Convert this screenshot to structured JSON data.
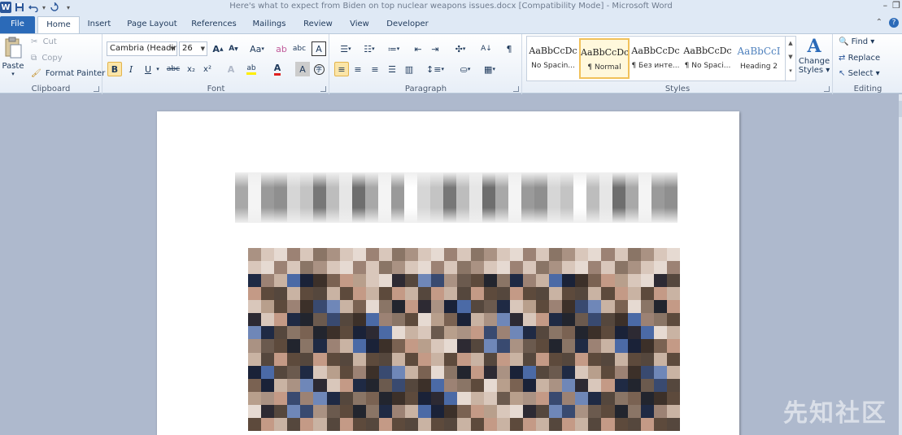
{
  "titlebar": {
    "title": "Here's what to expect from Biden on top nuclear weapons issues.docx [Compatibility Mode]  -  Microsoft Word",
    "minimize": "–",
    "restore": "❐",
    "word_logo": "W",
    "undo_dropdown": "▾",
    "customize": "▾"
  },
  "tabs": [
    {
      "label": "File"
    },
    {
      "label": "Home"
    },
    {
      "label": "Insert"
    },
    {
      "label": "Page Layout"
    },
    {
      "label": "References"
    },
    {
      "label": "Mailings"
    },
    {
      "label": "Review"
    },
    {
      "label": "View"
    },
    {
      "label": "Developer"
    }
  ],
  "clipboard": {
    "paste": "Paste",
    "cut": "Cut",
    "copy": "Copy",
    "format_painter": "Format Painter",
    "label": "Clipboard"
  },
  "font": {
    "font_name": "Cambria (Headir",
    "font_size": "26",
    "label": "Font",
    "grow": "A",
    "shrink": "A",
    "change_case": "Aa",
    "bold": "B",
    "italic": "I",
    "underline": "U",
    "strike": "abc",
    "subscript": "x₂",
    "superscript": "x²",
    "font_color": "A",
    "char_shading": "A"
  },
  "paragraph": {
    "label": "Paragraph",
    "pilcrow": "¶"
  },
  "styles": {
    "label": "Styles",
    "items": [
      {
        "sample": "AaBbCcDc",
        "name": "No Spacin..."
      },
      {
        "sample": "AaBbCcDc",
        "name": "¶ Normal"
      },
      {
        "sample": "AaBbCcDc",
        "name": "¶ Без инте..."
      },
      {
        "sample": "AaBbCcDc",
        "name": "¶ No Spaci..."
      },
      {
        "sample": "AaBbCcI",
        "name": "Heading 2"
      }
    ],
    "change_styles_line1": "Change",
    "change_styles_line2": "Styles ▾"
  },
  "editing": {
    "label": "Editing",
    "find": "Find ▾",
    "replace": "Replace",
    "select": "Select ▾"
  },
  "watermark": "先知社区",
  "colors": {
    "ribbon_tab_file": "#2b6ab8",
    "doc_background": "#aeb9cd",
    "selected_style": "#f1c15a"
  }
}
